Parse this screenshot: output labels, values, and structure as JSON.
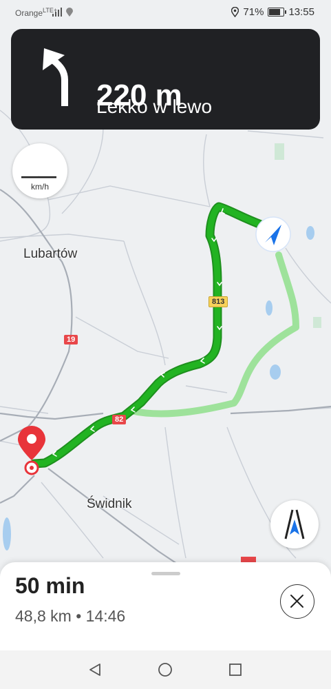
{
  "status_bar": {
    "carrier": "Orange",
    "network": "LTE+",
    "battery_percent": "71%",
    "time": "13:55"
  },
  "navigation_banner": {
    "distance": "220 m",
    "instruction": "Lekko w lewo",
    "maneuver_icon": "turn-slight-left-icon"
  },
  "speedometer": {
    "speed": "——",
    "unit": "km/h"
  },
  "map": {
    "places": [
      "Lubartów",
      "Świdnik"
    ],
    "road_shields": [
      {
        "label": "813",
        "color": "yellow"
      },
      {
        "label": "19",
        "color": "red"
      },
      {
        "label": "82",
        "color": "red"
      }
    ],
    "route_color": "#1faa1f",
    "alt_route_color": "#9ee29b",
    "destination_marker_color": "#e8343a",
    "location_arrow_color": "#1a73e8"
  },
  "trip_summary": {
    "duration": "50 min",
    "distance": "48,8 km",
    "separator": "•",
    "arrival_time": "14:46"
  }
}
